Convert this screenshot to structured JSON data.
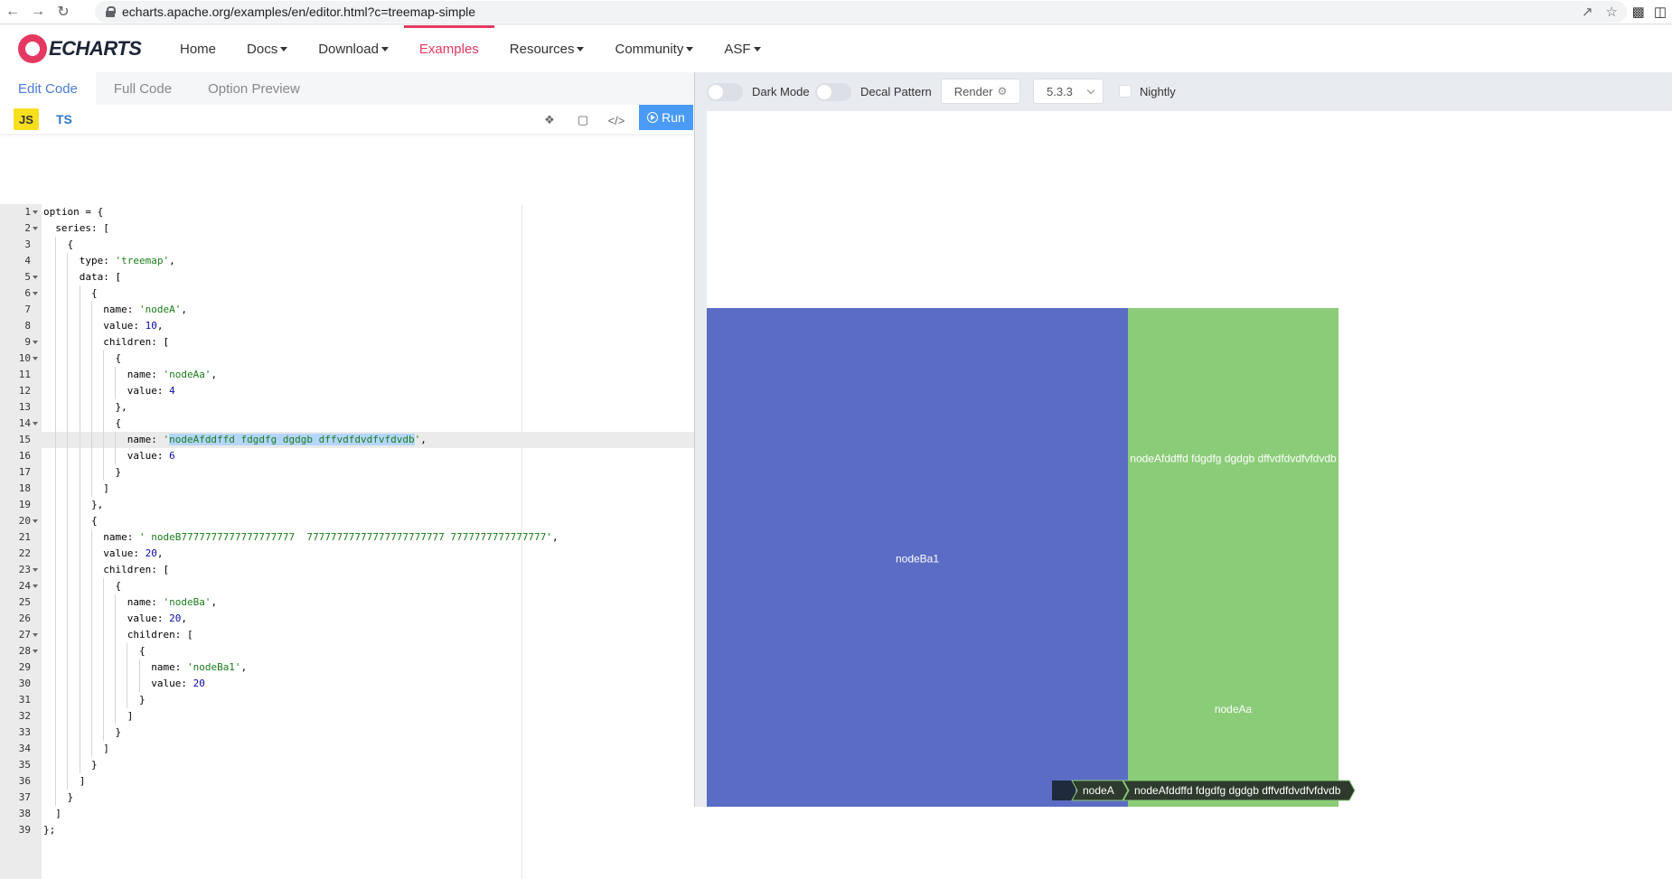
{
  "browser": {
    "url": "echarts.apache.org/examples/en/editor.html?c=treemap-simple"
  },
  "site": {
    "logo_text": "ECHARTS",
    "nav": [
      {
        "label": "Home",
        "dropdown": false
      },
      {
        "label": "Docs",
        "dropdown": true
      },
      {
        "label": "Download",
        "dropdown": true
      },
      {
        "label": "Examples",
        "dropdown": false,
        "active": true
      },
      {
        "label": "Resources",
        "dropdown": true
      },
      {
        "label": "Community",
        "dropdown": true
      },
      {
        "label": "ASF",
        "dropdown": true
      }
    ],
    "accent_color": "#e43961"
  },
  "editor": {
    "tabs": [
      "Edit Code",
      "Full Code",
      "Option Preview"
    ],
    "lang_js": "JS",
    "lang_ts": "TS",
    "run_label": "Run",
    "code_lines": [
      "option = {",
      "  series: [",
      "    {",
      "      type: 'treemap',",
      "      data: [",
      "        {",
      "          name: 'nodeA',",
      "          value: 10,",
      "          children: [",
      "            {",
      "              name: 'nodeAa',",
      "              value: 4",
      "            },",
      "            {",
      "              name: 'nodeAfddffd fdgdfg dgdgb dffvdfdvdfvfdvdb',",
      "              value: 6",
      "            }",
      "          ]",
      "        },",
      "        {",
      "          name: ' nodeB7777777777777777777  77777777777777777777777 7777777777777777',",
      "          value: 20,",
      "          children: [",
      "            {",
      "              name: 'nodeBa',",
      "              value: 20,",
      "              children: [",
      "                {",
      "                  name: 'nodeBa1',",
      "                  value: 20",
      "                }",
      "              ]",
      "            }",
      "          ]",
      "        }",
      "      ]",
      "    }",
      "  ]",
      "};"
    ],
    "highlighted_line": 15,
    "fold_lines": [
      1,
      2,
      5,
      6,
      9,
      10,
      14,
      20,
      23,
      24,
      27,
      28
    ]
  },
  "preview": {
    "dark_mode_label": "Dark Mode",
    "decal_label": "Decal Pattern",
    "render_label": "Render",
    "version": "5.3.3",
    "nightly_label": "Nightly"
  },
  "chart_data": {
    "type": "treemap",
    "nodes": [
      {
        "name": "nodeBa1",
        "value": 20,
        "color": "#5b6cc4"
      },
      {
        "name": "nodeAfddffd fdgdfg dgdgb dffvdfdvdfvfdvdb",
        "value": 6,
        "color": "#8bcc78"
      },
      {
        "name": "nodeAa",
        "value": 4,
        "color": "#8bcc78"
      }
    ],
    "breadcrumb": [
      "nodeA",
      "nodeAfddffd fdgdfg dgdgb dffvdfdvdfvfdvdb"
    ]
  }
}
